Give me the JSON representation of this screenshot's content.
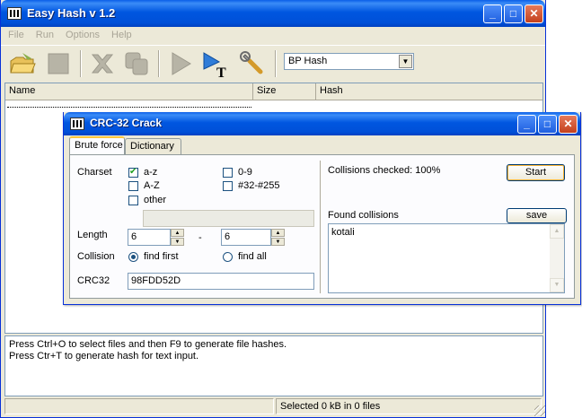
{
  "main": {
    "title": "Easy Hash v 1.2",
    "menu": [
      "File",
      "Run",
      "Options",
      "Help"
    ],
    "hash_select": {
      "value": "BP Hash"
    },
    "columns": [
      "Name",
      "Size",
      "Hash"
    ],
    "info_lines": [
      "Press Ctrl+O to select files and then F9 to generate file hashes.",
      "Press Ctr+T to generate hash for text input."
    ],
    "status": "Selected 0 kB in 0 files"
  },
  "dialog": {
    "title": "CRC-32 Crack",
    "tabs": [
      "Brute force",
      "Dictionary"
    ],
    "charset_label": "Charset",
    "charsets": [
      {
        "label": "a-z",
        "checked": true
      },
      {
        "label": "0-9",
        "checked": false
      },
      {
        "label": "A-Z",
        "checked": false
      },
      {
        "label": "#32-#255",
        "checked": false
      },
      {
        "label": "other",
        "checked": false
      }
    ],
    "other_value": "",
    "length_label": "Length",
    "length_min": "6",
    "length_dash": "-",
    "length_max": "6",
    "collision_label": "Collision",
    "collision_options": [
      {
        "label": "find first",
        "selected": true
      },
      {
        "label": "find all",
        "selected": false
      }
    ],
    "crc_label": "CRC32",
    "crc_value": "98FDD52D",
    "collisions_checked": "Collisions checked: 100%",
    "start_button": "Start",
    "found_label": "Found collisions",
    "save_button": "save",
    "found_items": [
      "kotali"
    ]
  }
}
